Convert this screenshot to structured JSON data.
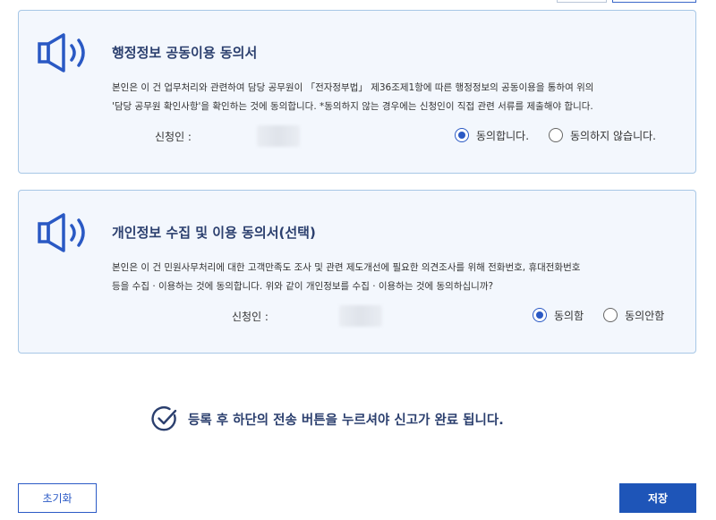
{
  "colors": {
    "accent": "#1e55b8",
    "title": "#2b3f6e",
    "card_bg": "#f3f7fd",
    "card_border": "#a7c7e6"
  },
  "cards": [
    {
      "icon": "speaker-icon",
      "title": "행정정보 공동이용 동의서",
      "body": [
        "본인은 이 건 업무처리와 관련하여 담당 공무원이 「전자정부법」 제36조제1항에 따른 행정정보의 공동이용을 통하여 위의",
        "'담당 공무원 확인사항'을 확인하는 것에 동의합니다. *동의하지 않는 경우에는 신청인이 직접 관련 서류를 제출해야 합니다."
      ],
      "applicant_label": "신청인 :",
      "options": [
        {
          "label": "동의합니다.",
          "selected": true
        },
        {
          "label": "동의하지 않습니다.",
          "selected": false
        }
      ]
    },
    {
      "icon": "speaker-icon",
      "title": "개인정보 수집 및 이용 동의서(선택)",
      "body": [
        "본인은 이 건 민원사무처리에 대한 고객만족도 조사 및 관련 제도개선에 필요한 의견조사를 위해 전화번호, 휴대전화번호",
        "등을 수집 · 이용하는 것에 동의합니다. 위와 같이 개인정보를 수집 · 이용하는 것에 동의하십니까?"
      ],
      "applicant_label": "신청인 :",
      "options": [
        {
          "label": "동의함",
          "selected": true
        },
        {
          "label": "동의안함",
          "selected": false
        }
      ]
    }
  ],
  "notice": {
    "icon": "check-circle-icon",
    "text": "등록 후 하단의 전송 버튼을 누르셔야 신고가 완료 됩니다."
  },
  "buttons": {
    "reset_label": "초기화",
    "save_label": "저장"
  }
}
